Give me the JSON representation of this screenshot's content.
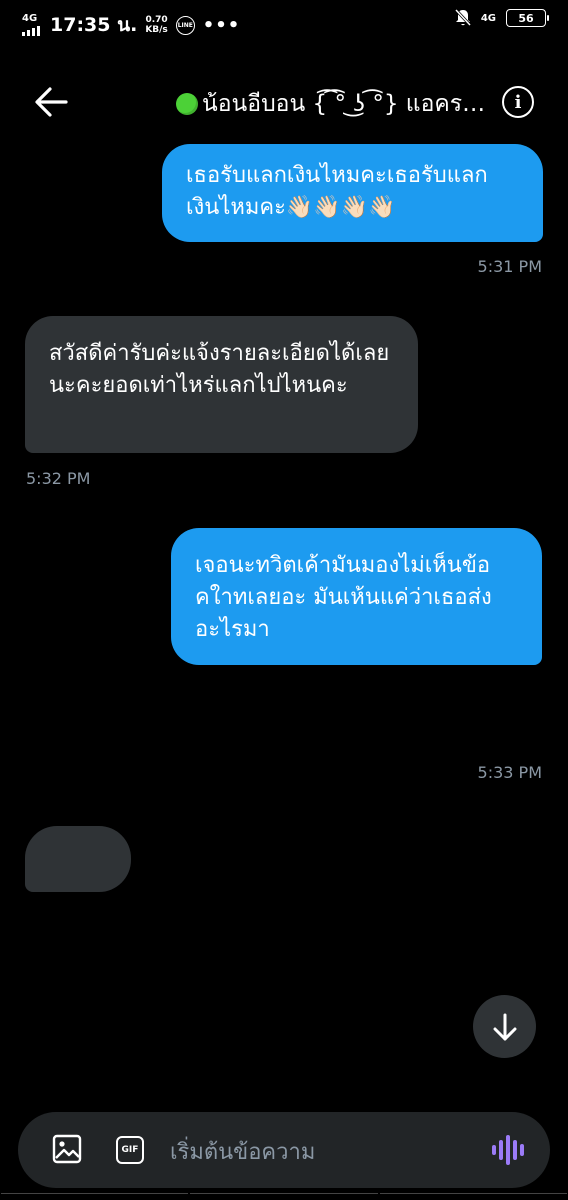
{
  "status_bar": {
    "network_left": "4G",
    "time": "17:35 น.",
    "speed_value": "0.70",
    "speed_unit": "KB/s",
    "line_icon_text": "LINE",
    "more_dots": "•••",
    "network_right": "4G",
    "battery": "56"
  },
  "header": {
    "back_icon": "arrow-left-icon",
    "title": "น้อนอีบอน {͡ ͡° ͜ʖ ͡°} แอครองครอง",
    "info_icon": "info-icon"
  },
  "messages": [
    {
      "direction": "sent",
      "text": "เธอรับแลกเงินไหมคะเธอรับแลกเงินไหมคะ👋🏻👋🏻👋🏻👋🏻",
      "time": "5:31 PM"
    },
    {
      "direction": "received",
      "text": "สวัสดีค่ารับค่ะแจ้งรายละเอียดได้เลยนะคะยอดเท่าไหร่แลกไปไหนคะ",
      "time": "5:32 PM"
    },
    {
      "direction": "sent",
      "text": "เจอนะทวิตเค้ามันมองไม่เห็นข้อคใาทเลยอะ มันเห้นแค่ว่าเธอส่งอะไรมา",
      "time": "5:33 PM"
    },
    {
      "direction": "received",
      "text": "",
      "time": ""
    }
  ],
  "scroll_down_icon": "arrow-down-icon",
  "composer": {
    "image_icon": "image-icon",
    "gif_label": "GIF",
    "placeholder": "เริ่มต้นข้อความ",
    "voice_icon": "voice-wave-icon"
  },
  "colors": {
    "sent_bubble": "#1d9bf0",
    "received_bubble": "#2f3336",
    "voice_accent": "#9b7bf7",
    "online_dot": "#4cd137"
  }
}
